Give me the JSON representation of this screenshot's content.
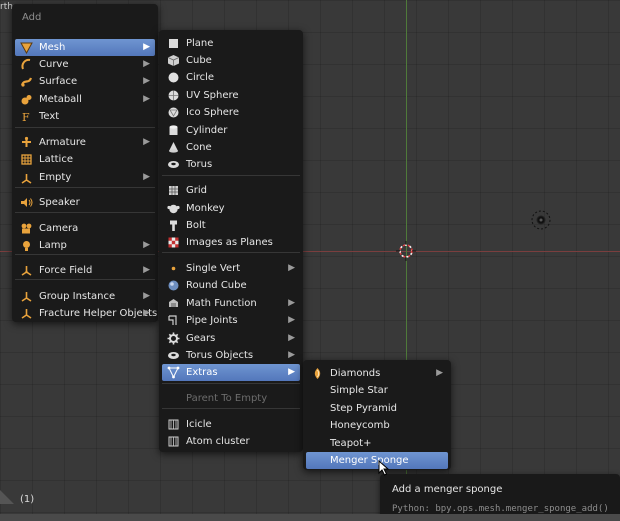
{
  "viewport": {
    "corner_text": "rth",
    "frame_label": "(1)"
  },
  "main_menu": {
    "title": "Add",
    "items": [
      {
        "label": "Mesh",
        "icon": "mesh-icon",
        "submenu": true,
        "highlight": true
      },
      {
        "label": "Curve",
        "icon": "curve-icon",
        "submenu": true
      },
      {
        "label": "Surface",
        "icon": "surface-icon",
        "submenu": true
      },
      {
        "label": "Metaball",
        "icon": "metaball-icon",
        "submenu": true
      },
      {
        "label": "Text",
        "icon": "text-icon",
        "submenu": false
      },
      {
        "label": "Armature",
        "icon": "armature-icon",
        "submenu": true
      },
      {
        "label": "Lattice",
        "icon": "lattice-icon",
        "submenu": false
      },
      {
        "label": "Empty",
        "icon": "empty-icon",
        "submenu": true
      },
      {
        "label": "Speaker",
        "icon": "speaker-icon",
        "submenu": false
      },
      {
        "label": "Camera",
        "icon": "camera-icon",
        "submenu": false
      },
      {
        "label": "Lamp",
        "icon": "lamp-icon",
        "submenu": true
      },
      {
        "label": "Force Field",
        "icon": "force-field-icon",
        "submenu": true
      },
      {
        "label": "Group Instance",
        "icon": "group-instance-icon",
        "submenu": true
      },
      {
        "label": "Fracture Helper Objects",
        "icon": "fracture-helper-icon",
        "submenu": true
      }
    ]
  },
  "mesh_menu": {
    "items": [
      {
        "label": "Plane",
        "icon": "plane-icon"
      },
      {
        "label": "Cube",
        "icon": "cube-icon"
      },
      {
        "label": "Circle",
        "icon": "circle-icon"
      },
      {
        "label": "UV Sphere",
        "icon": "uv-sphere-icon"
      },
      {
        "label": "Ico Sphere",
        "icon": "ico-sphere-icon"
      },
      {
        "label": "Cylinder",
        "icon": "cylinder-icon"
      },
      {
        "label": "Cone",
        "icon": "cone-icon"
      },
      {
        "label": "Torus",
        "icon": "torus-icon"
      },
      {
        "label": "Grid",
        "icon": "grid-icon"
      },
      {
        "label": "Monkey",
        "icon": "monkey-icon"
      },
      {
        "label": "Bolt",
        "icon": "bolt-icon"
      },
      {
        "label": "Images as Planes",
        "icon": "images-as-planes-icon"
      },
      {
        "label": "Single Vert",
        "icon": "single-vert-icon",
        "submenu": true
      },
      {
        "label": "Round Cube",
        "icon": "round-cube-icon"
      },
      {
        "label": "Math Function",
        "icon": "math-function-icon",
        "submenu": true
      },
      {
        "label": "Pipe Joints",
        "icon": "pipe-joints-icon",
        "submenu": true
      },
      {
        "label": "Gears",
        "icon": "gears-icon",
        "submenu": true
      },
      {
        "label": "Torus Objects",
        "icon": "torus-objects-icon",
        "submenu": true
      },
      {
        "label": "Extras",
        "icon": "extras-icon",
        "submenu": true,
        "highlight": true
      },
      {
        "label": "Parent To Empty",
        "icon": "parent-to-empty-icon",
        "disabled": true
      },
      {
        "label": "Icicle",
        "icon": "icicle-icon"
      },
      {
        "label": "Atom cluster",
        "icon": "atom-cluster-icon"
      }
    ]
  },
  "extras_menu": {
    "items": [
      {
        "label": "Diamonds",
        "icon": "diamonds-icon",
        "submenu": true
      },
      {
        "label": "Simple Star"
      },
      {
        "label": "Step Pyramid"
      },
      {
        "label": "Honeycomb"
      },
      {
        "label": "Teapot+"
      },
      {
        "label": "Menger Sponge",
        "highlight": true
      }
    ]
  },
  "tooltip": {
    "title": "Add a menger sponge",
    "python": "Python: bpy.ops.mesh.menger_sponge_add()"
  },
  "colors": {
    "menu_bg": "#1a1a1a",
    "highlight": "#5e82c4",
    "viewport_bg": "#393939",
    "x_axis": "#7a3e3e",
    "y_axis": "#4f7a3a"
  }
}
